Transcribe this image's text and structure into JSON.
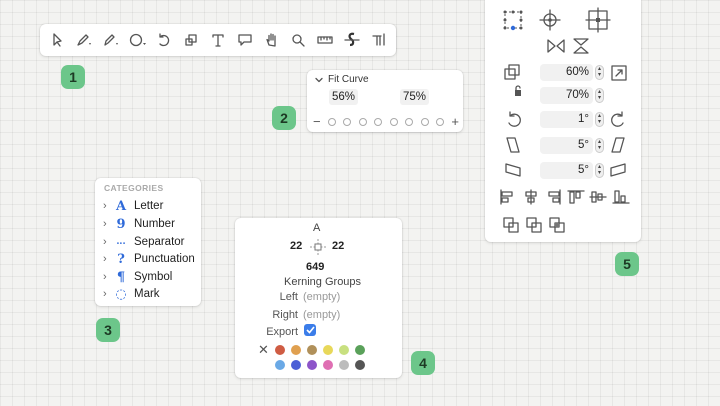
{
  "badges": [
    "1",
    "2",
    "3",
    "4",
    "5"
  ],
  "toolbar": {
    "tools": [
      "select-tool-icon",
      "pen-tool-icon",
      "pencil-tool-icon",
      "brush-tool-icon",
      "rotate-tool-icon",
      "scale-tool-icon",
      "text-tool-icon",
      "annotation-tool-icon",
      "hand-tool-icon",
      "zoom-tool-icon",
      "measure-tool-icon",
      "knife-tool-icon",
      "hint-tool-icon"
    ]
  },
  "fit_curve": {
    "title": "Fit Curve",
    "left_pct": "56%",
    "right_pct": "75%",
    "minus": "−",
    "plus": "+",
    "steps": 8
  },
  "categories": {
    "title": "CATEGORIES",
    "items": [
      {
        "symbol": "A",
        "label": "Letter"
      },
      {
        "symbol": "9",
        "label": "Number"
      },
      {
        "symbol": "‥.",
        "label": "Separator"
      },
      {
        "symbol": "?",
        "label": "Punctuation"
      },
      {
        "symbol": "¶",
        "label": "Symbol"
      },
      {
        "symbol": "◌",
        "label": "Mark"
      }
    ]
  },
  "glyph": {
    "name": "A",
    "lsb": "22",
    "rsb": "22",
    "width": "649",
    "kerning_title": "Kerning Groups",
    "left_label": "Left",
    "left_value": "(empty)",
    "right_label": "Right",
    "right_value": "(empty)",
    "export_label": "Export",
    "clear_symbol": "✕",
    "colors_row1": [
      "#cf5c43",
      "#e0a050",
      "#b0905a",
      "#e8d85a",
      "#c8e080",
      "#5aa15a"
    ],
    "colors_row2": [
      "#6aa9e6",
      "#4b5fd6",
      "#8d55c9",
      "#df6fb3",
      "#bcbcbc",
      "#555555"
    ]
  },
  "transform": {
    "scale_x": "60%",
    "scale_y": "70%",
    "rotate": "1°",
    "slant_x": "5°",
    "slant_y": "5°"
  }
}
